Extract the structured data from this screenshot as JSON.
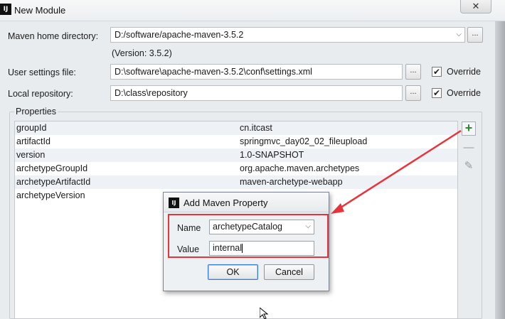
{
  "window": {
    "title": "New Module",
    "app_icon": "IJ",
    "close_label": "✕"
  },
  "form": {
    "maven_home_label": "Maven home directory:",
    "maven_home_value": "D:/software/apache-maven-3.5.2",
    "version_text": "(Version: 3.5.2)",
    "user_settings_label": "User settings file:",
    "user_settings_value": "D:\\software\\apache-maven-3.5.2\\conf\\settings.xml",
    "local_repo_label": "Local repository:",
    "local_repo_value": "D:\\class\\repository",
    "browse_label": "...",
    "override_label": "Override",
    "override_user_settings_checked": true,
    "override_local_repo_checked": true,
    "check_mark": "✔"
  },
  "properties": {
    "legend": "Properties",
    "rows": [
      {
        "key": "groupId",
        "value": "cn.itcast"
      },
      {
        "key": "artifactId",
        "value": "springmvc_day02_02_fileupload"
      },
      {
        "key": "version",
        "value": "1.0-SNAPSHOT"
      },
      {
        "key": "archetypeGroupId",
        "value": "org.apache.maven.archetypes"
      },
      {
        "key": "archetypeArtifactId",
        "value": "maven-archetype-webapp"
      },
      {
        "key": "archetypeVersion",
        "value": ""
      }
    ],
    "add_symbol": "+",
    "remove_symbol": "—",
    "edit_symbol": "✎"
  },
  "dialog": {
    "title": "Add Maven Property",
    "icon": "IJ",
    "name_label": "Name",
    "name_value": "archetypeCatalog",
    "value_label": "Value",
    "value_value": "internal",
    "ok_label": "OK",
    "cancel_label": "Cancel"
  },
  "colors": {
    "annotation_red": "#e8333b",
    "add_green": "#2d8a2d"
  }
}
